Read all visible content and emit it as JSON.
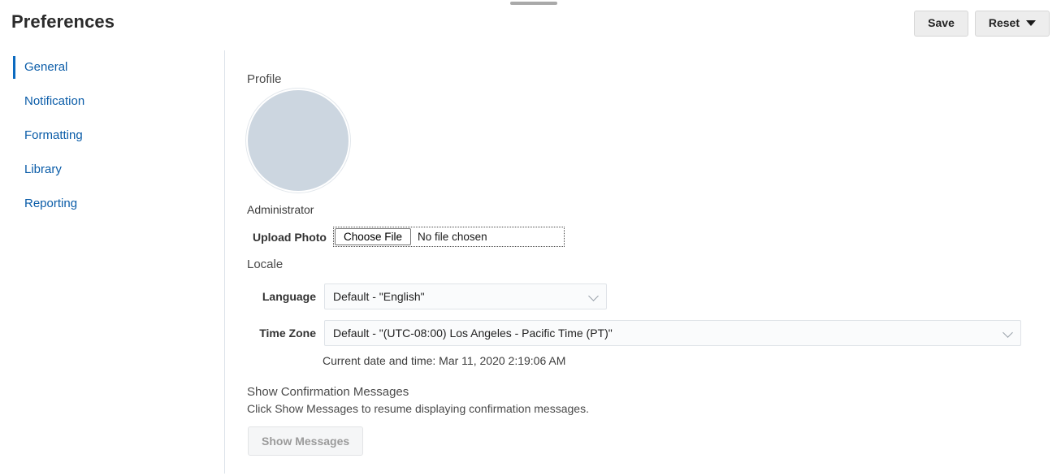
{
  "window": {
    "drag_handle": "drag-handle"
  },
  "header": {
    "title": "Preferences",
    "save_label": "Save",
    "reset_label": "Reset"
  },
  "sidebar": {
    "items": [
      {
        "label": "General",
        "active": true
      },
      {
        "label": "Notification",
        "active": false
      },
      {
        "label": "Formatting",
        "active": false
      },
      {
        "label": "Library",
        "active": false
      },
      {
        "label": "Reporting",
        "active": false
      }
    ]
  },
  "main": {
    "profile": {
      "section_label": "Profile",
      "user_name": "Administrator",
      "upload_label": "Upload Photo",
      "choose_file_label": "Choose File",
      "file_status": "No file chosen"
    },
    "locale": {
      "section_label": "Locale",
      "language_label": "Language",
      "language_value": "Default - \"English\"",
      "timezone_label": "Time Zone",
      "timezone_value": "Default - \"(UTC-08:00) Los Angeles - Pacific Time (PT)\"",
      "current_datetime": "Current date and time: Mar 11, 2020 2:19:06 AM"
    },
    "confirmation": {
      "title": "Show Confirmation Messages",
      "description": "Click Show Messages to resume displaying confirmation messages.",
      "button_label": "Show Messages"
    }
  },
  "colors": {
    "link": "#0a5ca8",
    "active_indicator": "#0b6ac0",
    "avatar_fill": "#ccd6e0",
    "divider": "#dde3ea"
  }
}
